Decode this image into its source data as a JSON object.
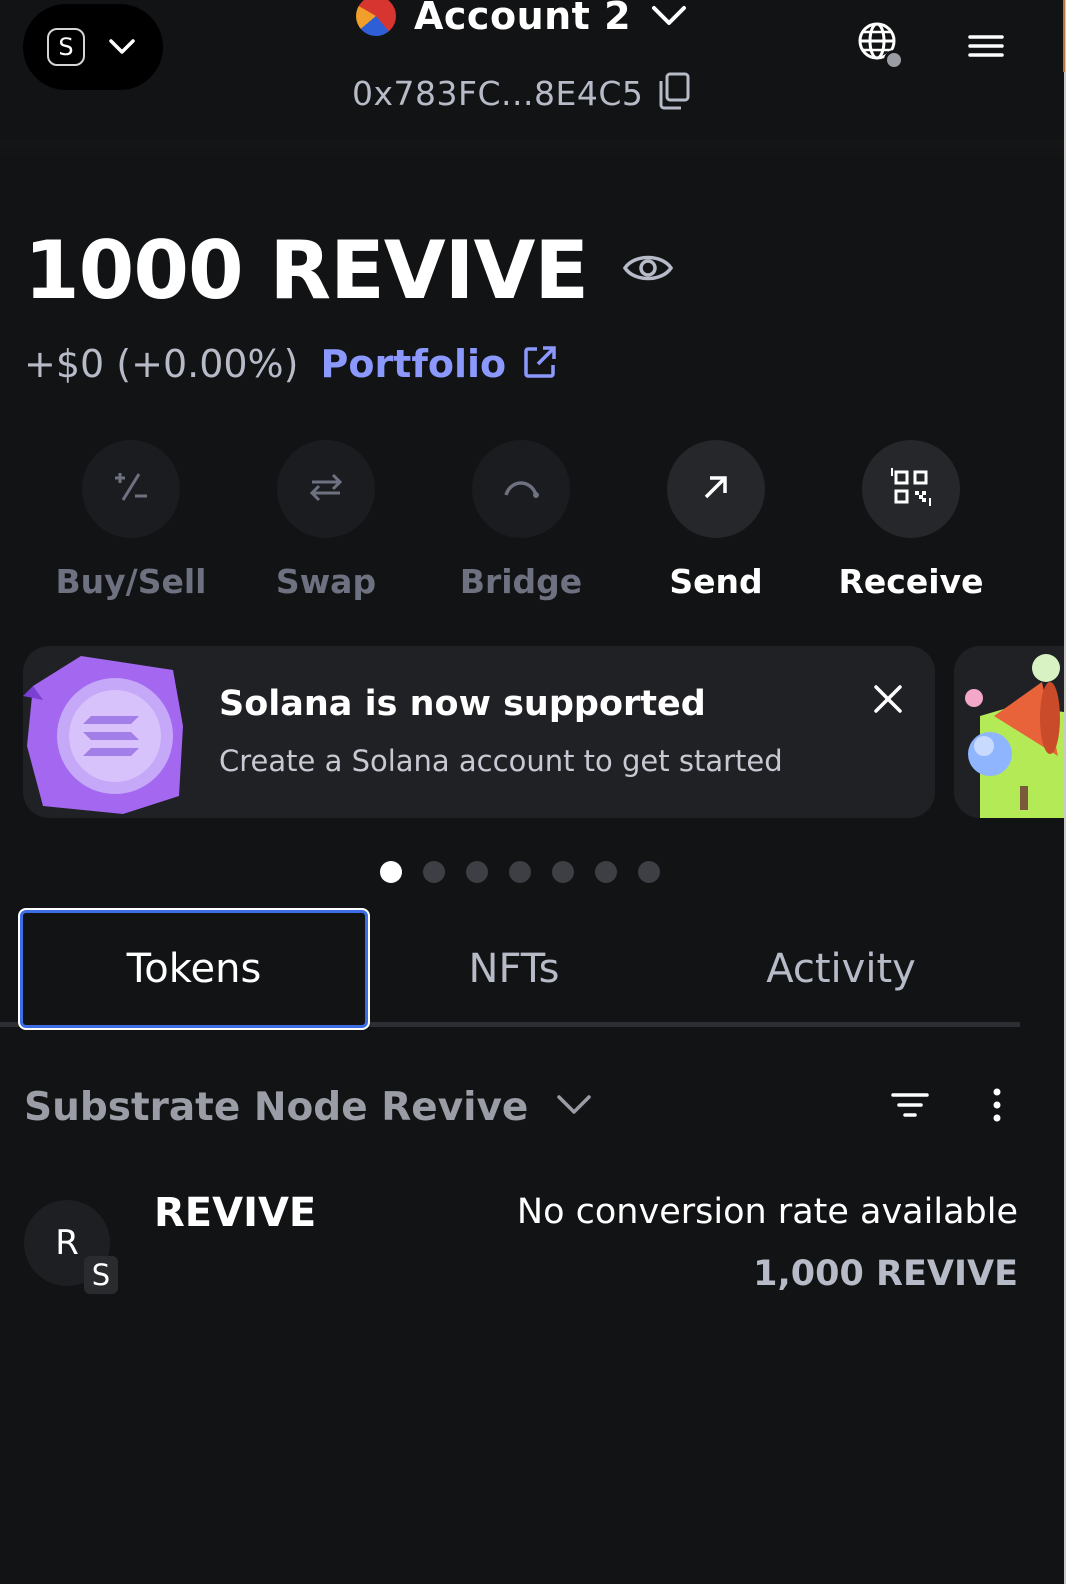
{
  "header": {
    "network_avatar_letter": "S",
    "account_name": "Account 2",
    "address": "0x783FC...8E4C5",
    "icons": {
      "network_dropdown": "chevron-down-icon",
      "account_dropdown": "chevron-down-icon",
      "copy": "copy-icon",
      "connections": "globe-icon",
      "menu": "hamburger-menu-icon"
    }
  },
  "balance": {
    "amount": "1000 REVIVE",
    "change": "+$0 (+0.00%)",
    "portfolio_label": "Portfolio",
    "icons": {
      "visibility": "eye-icon",
      "portfolio": "external-link-icon"
    }
  },
  "actions": [
    {
      "label": "Buy/Sell",
      "icon": "plus-minus-icon",
      "enabled": false
    },
    {
      "label": "Swap",
      "icon": "swap-arrows-icon",
      "enabled": false
    },
    {
      "label": "Bridge",
      "icon": "bridge-icon",
      "enabled": false
    },
    {
      "label": "Send",
      "icon": "arrow-up-right-icon",
      "enabled": true
    },
    {
      "label": "Receive",
      "icon": "qr-code-icon",
      "enabled": true
    }
  ],
  "banner": {
    "title": "Solana is now supported",
    "subtitle": "Create a Solana account to get started",
    "icon": "solana-coin-icon",
    "close_icon": "close-icon",
    "next_card_icon": "megaphone-icon"
  },
  "carousel": {
    "count": 7,
    "active_index": 0
  },
  "tabs": [
    {
      "label": "Tokens",
      "active": true
    },
    {
      "label": "NFTs",
      "active": false
    },
    {
      "label": "Activity",
      "active": false
    }
  ],
  "network_filter": {
    "label": "Substrate Node Revive",
    "icons": {
      "dropdown": "chevron-down-icon",
      "sort": "filter-icon",
      "more": "more-vertical-icon"
    }
  },
  "tokens": [
    {
      "avatar_letter": "R",
      "network_badge_letter": "S",
      "name": "REVIVE",
      "rate": "No conversion rate available",
      "amount": "1,000 REVIVE"
    }
  ],
  "colors": {
    "background": "#121314",
    "card": "#202124",
    "accent_link": "#8b99ff",
    "tab_focus": "#3e6ee6",
    "muted_text": "#b7bbc8",
    "disabled_text": "#6e7180"
  }
}
